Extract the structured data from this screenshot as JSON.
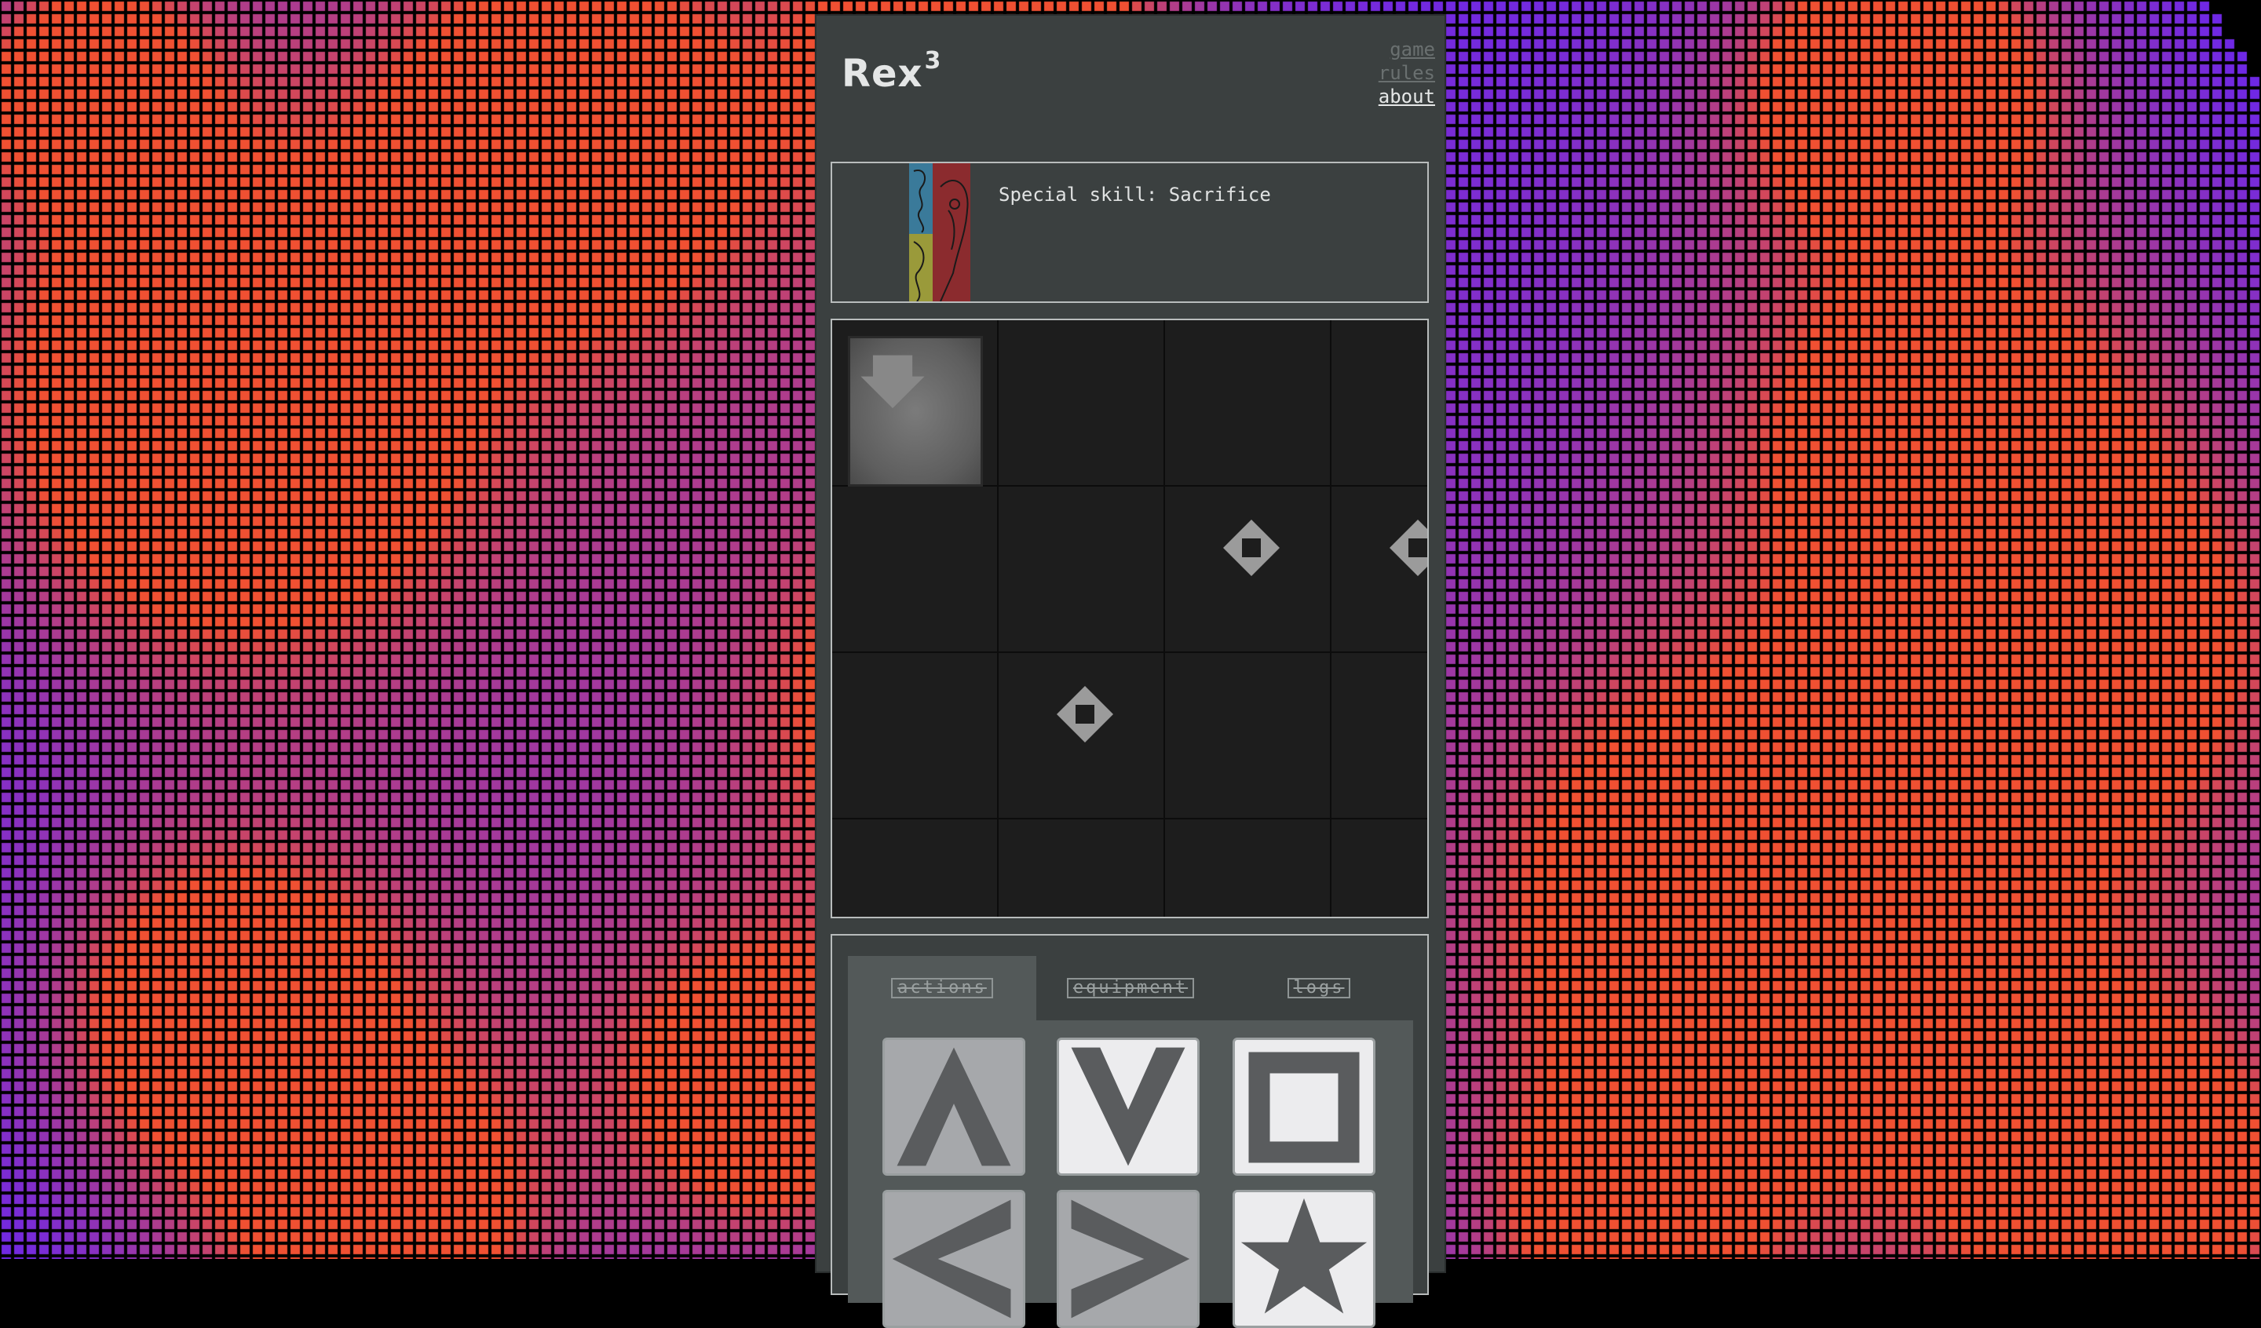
{
  "app": {
    "title": "Rex",
    "title_sup": "3",
    "nav": [
      {
        "label": "game",
        "active": false
      },
      {
        "label": "rules",
        "active": false
      },
      {
        "label": "about",
        "active": true
      }
    ]
  },
  "unit": {
    "skill_text": "Special skill: Sacrifice",
    "portrait_icon": "unit-portrait-icon"
  },
  "board": {
    "cards": [
      "face-down-card-icon"
    ],
    "markers": [
      "move-marker-icon",
      "move-marker-icon",
      "move-marker-icon"
    ]
  },
  "actions": {
    "tabs": [
      {
        "label": "actions",
        "active": true
      },
      {
        "label": "equipment",
        "active": false
      },
      {
        "label": "logs",
        "active": false
      }
    ],
    "buttons": [
      {
        "icon": "up-chevron-icon",
        "enabled": false
      },
      {
        "icon": "down-chevron-icon",
        "enabled": true
      },
      {
        "icon": "square-stop-icon",
        "enabled": true
      },
      {
        "icon": "left-chevron-icon",
        "enabled": false
      },
      {
        "icon": "right-chevron-icon",
        "enabled": false
      },
      {
        "icon": "star-icon",
        "enabled": true
      }
    ]
  },
  "colors": {
    "panel": "#3b4040",
    "board": "#1d1d1d",
    "accent_red": "#8b2b2e",
    "accent_blue": "#3a7a9a",
    "accent_yellow": "#9a9a3a"
  }
}
